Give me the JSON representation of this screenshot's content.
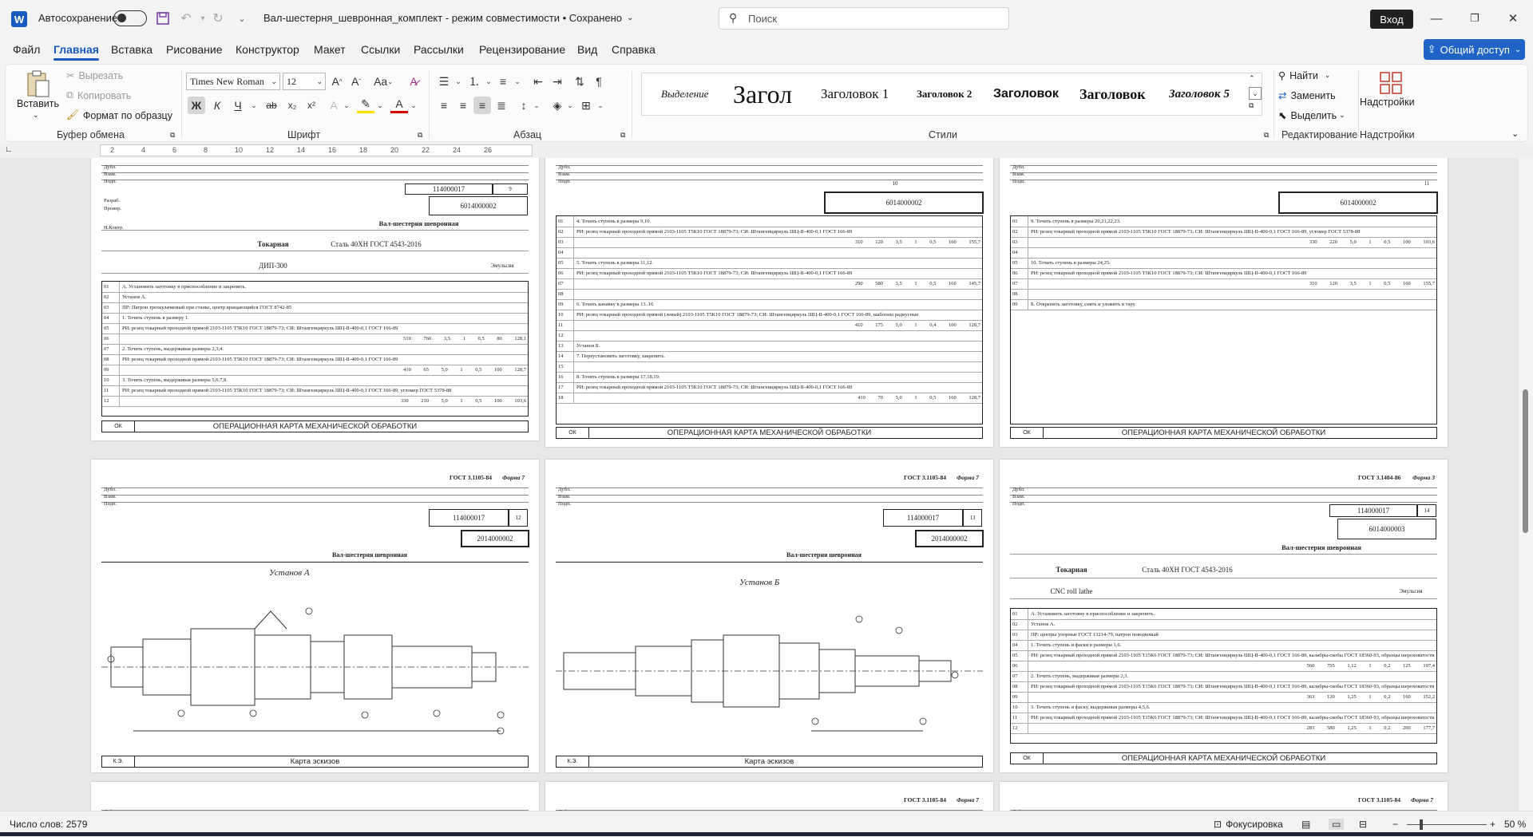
{
  "titlebar": {
    "autosave_label": "Автосохранение",
    "doc_title": "Вал-шестерня_шевронная_комплект  -  режим совместимости  •  Сохранено",
    "search_placeholder": "Поиск",
    "signin_label": "Вход"
  },
  "tabs": [
    "Файл",
    "Главная",
    "Вставка",
    "Рисование",
    "Конструктор",
    "Макет",
    "Ссылки",
    "Рассылки",
    "Рецензирование",
    "Вид",
    "Справка"
  ],
  "share_label": "Общий доступ",
  "ribbon": {
    "clipboard": {
      "paste": "Вставить",
      "cut": "Вырезать",
      "copy": "Копировать",
      "format_painter": "Формат по образцу",
      "label": "Буфер обмена"
    },
    "font": {
      "name": "Times New Roman",
      "size": "12",
      "bold": "Ж",
      "italic": "К",
      "underline": "Ч",
      "label": "Шрифт"
    },
    "paragraph": {
      "label": "Абзац"
    },
    "styles": {
      "items": [
        "Выделение",
        "Загол",
        "Заголовок 1",
        "Заголовок 2",
        "Заголовок 3",
        "Заголовок",
        "Заголовок 5"
      ],
      "label": "Стили"
    },
    "editing": {
      "find": "Найти",
      "replace": "Заменить",
      "select": "Выделить",
      "label": "Редактирование"
    },
    "addins": {
      "button": "Надстройки",
      "label": "Надстройки"
    }
  },
  "ruler_marks": [
    "2",
    "4",
    "6",
    "8",
    "10",
    "12",
    "14",
    "16",
    "18",
    "20",
    "22",
    "24",
    "26"
  ],
  "pages": {
    "p1": {
      "number": "9",
      "code1": "114000017",
      "code2": "6014000002",
      "part": "Вал-шестерня шевронная",
      "op": "Токарная",
      "material": "Сталь 40ХН ГОСТ 4543-2016",
      "machine": "ДИП-300",
      "coolant": "Эмульсия",
      "rows": [
        "А. Установить заготовку в приспособление и закрепить.",
        "Установ А.",
        "ПР: Патрон трехкулачковый при станке, центр вращающийся ГОСТ 8742-85",
        "1. Точить ступень в размеру 1.",
        "РИ: резец токарный проходной прямой 2103-1105 Т5К10 ГОСТ 18879-73; СИ: Штангенциркуль ШЦ-II-400-0,1 ГОСТ 166-89",
        "510    760    3,5    1    0,5    80    128,1",
        "2. Точить ступень, выдерживая размеры 2,3,4.",
        "РИ: резец токарный проходной прямой 2103-1105 Т5К10 ГОСТ 18879-73; СИ: Штангенциркуль ШЦ-II-400-0,1 ГОСТ 166-89",
        "410    65    5,0    1    0,5    100    128,7",
        "3. Точить ступень, выдерживая размеры 5,6,7,8.",
        "РИ: резец токарный проходной прямой 2103-1105 Т5К10 ГОСТ 18879-73; СИ: Штангенциркуль ШЦ-II-400-0,1 ГОСТ 166-89, угломер ГОСТ 5378-88",
        "330    210    5,0    1    0,5    100    103,6"
      ],
      "footer": "ОПЕРАЦИОННАЯ КАРТА МЕХАНИЧЕСКОЙ ОБРАБОТКИ"
    },
    "p2": {
      "number": "10",
      "code2": "6014000002",
      "rows": [
        "4. Точить ступень в размеры 9,10.",
        "РИ: резец токарный проходной прямой 2103-1105 Т5К10 ГОСТ 18879-73; СИ: Штангенциркуль ШЦ-II-400-0,1 ГОСТ 166-89",
        "310    120    3,5    1    0,5    160    155,7",
        "",
        "5. Точить ступень в размеры 11,12.",
        "РИ: резец токарный проходной прямой 2103-1105 Т5К10 ГОСТ 18879-73; СИ: Штангенциркуль ШЦ-II-400-0,1 ГОСТ 166-89",
        "290    580    3,5    1    0,5    160    145,7",
        "",
        "6. Точить канавку в размеры 13..16",
        "РИ: резец токарный проходной прямой (левый) 2103-1105 Т5К10 ГОСТ 18879-73; СИ: Штангенциркуль ШЦ-II-400-0,1 ГОСТ 166-89, шаблоны радиусные",
        "410    175    5,0    1    0,4    100    128,7",
        "",
        "Установ Б.",
        "7. Переустановить заготовку, закрепить.",
        "",
        "8. Точить ступень в размеры 17,18,19.",
        "РИ: резец токарный проходной прямой 2103-1105 Т5К10 ГОСТ 18879-73; СИ: Штангенциркуль ШЦ-II-400-0,1 ГОСТ 166-89",
        "410    70    5,0    1    0,5    160    128,7"
      ],
      "footer": "ОПЕРАЦИОННАЯ КАРТА МЕХАНИЧЕСКОЙ ОБРАБОТКИ"
    },
    "p3": {
      "number": "11",
      "code2": "6014000002",
      "rows": [
        "9. Точить ступень в размеры 20,21,22,23.",
        "РИ: резец токарный проходной прямой 2103-1105 Т5К10 ГОСТ 18879-73; СИ: Штангенциркуль ШЦ-II-400-0,1 ГОСТ 166-89, угломер ГОСТ 5378-88",
        "330    220    5,0    1    0,5    100    103,6",
        "",
        "10. Точить ступень в размеры 24,25.",
        "РИ: резец токарный проходной прямой 2103-1105 Т5К10 ГОСТ 18879-73; СИ: Штангенциркуль ШЦ-II-400-0,1 ГОСТ 166-89",
        "310    120    3,5    1    0,5    160    155,7",
        "",
        "Б. Открепить заготовку, снять и уложить в тару."
      ],
      "footer": "ОПЕРАЦИОННАЯ КАРТА МЕХАНИЧЕСКОЙ ОБРАБОТКИ"
    },
    "p4": {
      "gost": "ГОСТ 3.1105-84",
      "form": "Форма 7",
      "number": "12",
      "code1": "114000017",
      "code2": "2014000002",
      "part": "Вал-шестерня шевронная",
      "sketch_title": "Установ А",
      "footer": "Карта эскизов",
      "ks": "К.Э."
    },
    "p5": {
      "gost": "ГОСТ 3.1105-84",
      "form": "Форма 7",
      "number": "13",
      "code1": "114000017",
      "code2": "2014000002",
      "part": "Вал-шестерня шевронная",
      "sketch_title": "Установ Б",
      "footer": "Карта эскизов",
      "ks": "К.Э."
    },
    "p6": {
      "gost": "ГОСТ 3.1404-86",
      "form": "Форма 3",
      "number": "14",
      "code1": "114000017",
      "code2": "6014000003",
      "part": "Вал-шестерня шевронная",
      "op": "Токарная",
      "material": "Сталь 40ХН ГОСТ 4543-2016",
      "machine": "CNC roll lathe",
      "coolant": "Эмульсия",
      "rows": [
        "А. Установить заготовку в приспособление и закрепить.",
        "Установ А.",
        "ПР: центры упорные ГОСТ 13214-79, патрон поводковый",
        "1. Точить ступень и фаски в размеры 1,6.",
        "РИ: резец токарный проходной прямой 2103-1105 Т15К6 ГОСТ 18879-73; СИ: Штангенциркуль ШЦ-II-400-0,1 ГОСТ 166-89, калибры-скобы ГОСТ 18360-93, образцы шероховатости",
        "560    755    1,12    1    0,2    125    197,4",
        "2. Точить ступень, выдерживая размеры 2,3.",
        "РИ: резец токарный проходной прямой 2103-1105 Т15К6 ГОСТ 18879-73; СИ: Штангенциркуль ШЦ-II-400-0,1 ГОСТ 166-89, калибры-скобы ГОСТ 18360-93, образцы шероховатости",
        "363    120    1,25    1    0,2    160    152,2",
        "3. Точить ступень и фаску, выдерживая размеры 4,5,6.",
        "РИ: резец токарный проходной прямой 2103-1105 Т15К6 ГОСТ 18879-73; СИ: Штангенциркуль ШЦ-II-400-0,1 ГОСТ 166-89, калибры-скобы ГОСТ 18360-93, образцы шероховатости",
        "283    580    1,25    1    0,2    200    177,7"
      ],
      "footer": "ОПЕРАЦИОННАЯ КАРТА МЕХАНИЧЕСКОЙ ОБРАБОТКИ"
    },
    "bottom_gost": [
      "ГОСТ 3.1105-84",
      "ГОСТ 3.1105-84"
    ],
    "bottom_form": [
      "Форма 7",
      "Форма 7"
    ]
  },
  "statusbar": {
    "word_count": "Число слов: 2579",
    "focus": "Фокусировка",
    "zoom": "50 %"
  }
}
